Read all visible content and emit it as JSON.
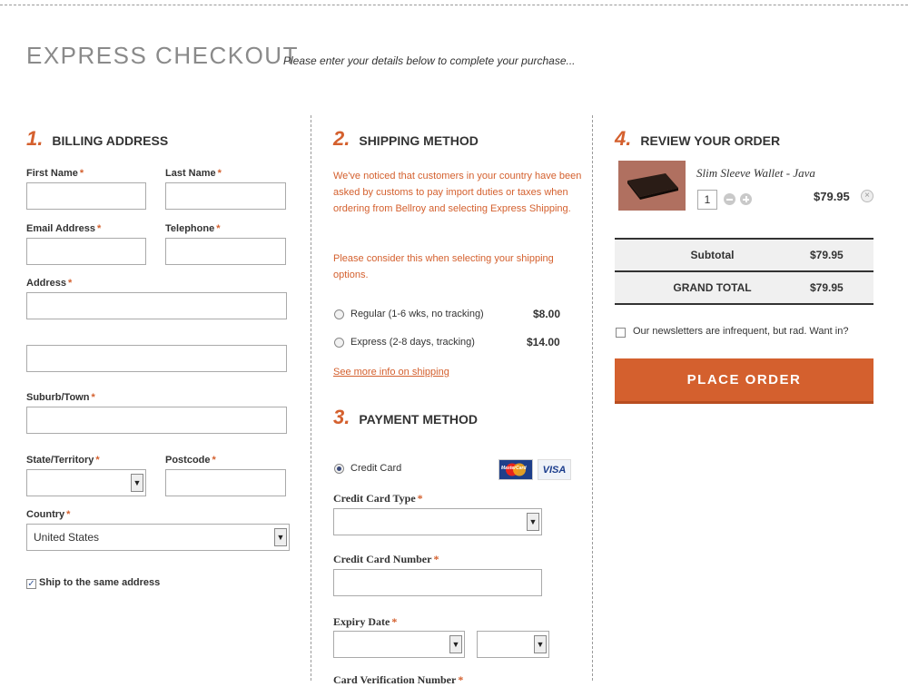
{
  "header": {
    "title": "EXPRESS CHECKOUT",
    "subtitle": "Please enter your details below to complete your purchase..."
  },
  "billing": {
    "number": "1.",
    "title": "BILLING ADDRESS",
    "first_name": "First Name",
    "last_name": "Last Name",
    "email": "Email Address",
    "telephone": "Telephone",
    "address": "Address",
    "suburb": "Suburb/Town",
    "state": "State/Territory",
    "postcode": "Postcode",
    "country": "Country",
    "country_value": "United States",
    "ship_same": "Ship to the same address",
    "required_mark": "*"
  },
  "shipping": {
    "number": "2.",
    "title": "SHIPPING METHOD",
    "notice1": "We've noticed that customers in your country have been asked by customs to pay import duties or taxes when ordering from Bellroy and selecting Express Shipping.",
    "notice2": "Please consider this when selecting your shipping options.",
    "options": [
      {
        "label": "Regular (1-6 wks, no tracking)",
        "price": "$8.00"
      },
      {
        "label": "Express (2-8 days, tracking)",
        "price": "$14.00"
      }
    ],
    "more_info": "See more info on shipping"
  },
  "payment": {
    "number": "3.",
    "title": "PAYMENT METHOD",
    "method_label": "Credit Card",
    "card_type": "Credit Card Type",
    "card_number": "Credit Card Number",
    "expiry": "Expiry Date",
    "cvn": "Card Verification Number",
    "mastercard_text": "MasterCard",
    "visa_text": "VISA"
  },
  "review": {
    "number": "4.",
    "title": "REVIEW YOUR ORDER",
    "product_name": "Slim Sleeve Wallet - Java",
    "quantity": "1",
    "product_price": "$79.95",
    "subtotal_label": "Subtotal",
    "subtotal_value": "$79.95",
    "grand_total_label": "GRAND TOTAL",
    "grand_total_value": "$79.95",
    "newsletter": "Our newsletters are infrequent, but rad. Want in?",
    "place_order": "PLACE ORDER"
  },
  "colors": {
    "accent": "#d4602e",
    "text": "#333333",
    "muted": "#8a8a8a"
  }
}
